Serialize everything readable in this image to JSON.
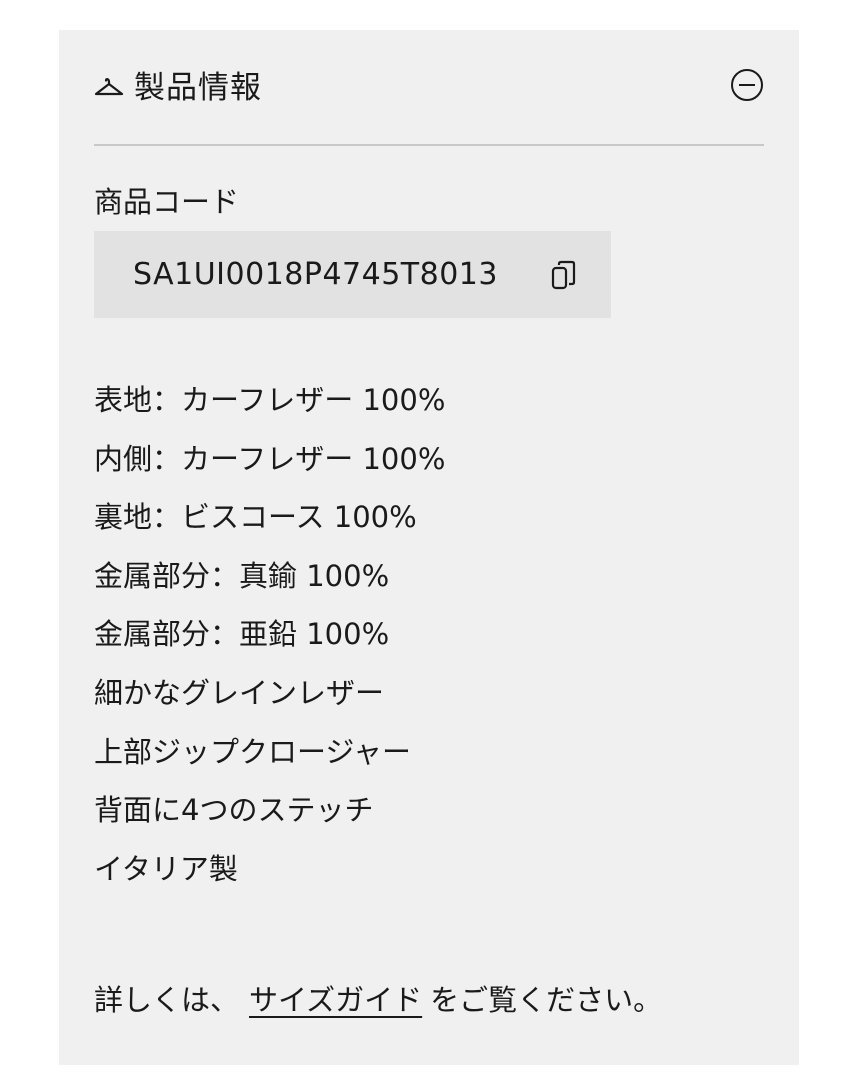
{
  "section": {
    "title": "製品情報",
    "icon": "hanger-icon",
    "toggle_icon": "minus-circle-icon"
  },
  "product_code": {
    "label": "商品コード",
    "value": "SA1UI0018P4745T8013",
    "copy_icon": "copy-icon"
  },
  "details": [
    "表地：カーフレザー 100%",
    "内側：カーフレザー 100%",
    "裏地：ビスコース 100%",
    "金属部分：真鍮 100%",
    "金属部分：亜鉛 100%",
    "細かなグレインレザー",
    "上部ジップクロージャー",
    "背面に4つのステッチ",
    "イタリア製"
  ],
  "footer": {
    "prefix": "詳しくは、",
    "link": "サイズガイド",
    "suffix": "をご覧ください。"
  },
  "colors": {
    "panel_background": "#f0f0f0",
    "code_background": "#e2e2e2",
    "text": "#1a1a1a",
    "divider": "#c8c8c8"
  }
}
